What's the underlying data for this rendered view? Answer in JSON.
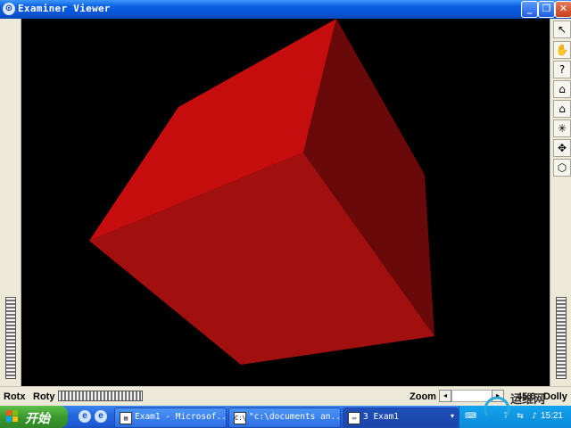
{
  "window": {
    "title": "Examiner Viewer",
    "icon": "coin-icon",
    "buttons": {
      "minimize": "_",
      "maximize": "❐",
      "close": "✕"
    }
  },
  "viewer": {
    "background_color": "#000000",
    "object_color": "#c00000",
    "face_colors": {
      "top": "#c50d0d",
      "front": "#a20f0f",
      "right": "#6a0909"
    }
  },
  "toolbar": [
    {
      "name": "select-icon",
      "glyph": "↖"
    },
    {
      "name": "hand-icon",
      "glyph": "✋"
    },
    {
      "name": "help-icon",
      "glyph": "?"
    },
    {
      "name": "home-icon",
      "glyph": "⌂"
    },
    {
      "name": "set-home-icon",
      "glyph": "⌂"
    },
    {
      "name": "view-all-icon",
      "glyph": "✳"
    },
    {
      "name": "seek-icon",
      "glyph": "✥"
    },
    {
      "name": "perspective-icon",
      "glyph": "⬡"
    }
  ],
  "bottom": {
    "rotx_label": "Rotx",
    "roty_label": "Roty",
    "zoom_label": "Zoom",
    "zoom_value": "45.0",
    "dolly_label": "Dolly"
  },
  "taskbar": {
    "start_label": "开始",
    "quicklaunch": [
      "e",
      "e"
    ],
    "tasks": [
      {
        "label": "Exam1 - Microsof...",
        "icon": "▤",
        "active": false
      },
      {
        "label": "\"c:\\documents an...",
        "icon": "C:\\",
        "active": false
      },
      {
        "label": "3 Exam1",
        "icon": "▭",
        "active": true
      }
    ],
    "clock": "15:21"
  },
  "watermark": {
    "text": "运维网"
  }
}
